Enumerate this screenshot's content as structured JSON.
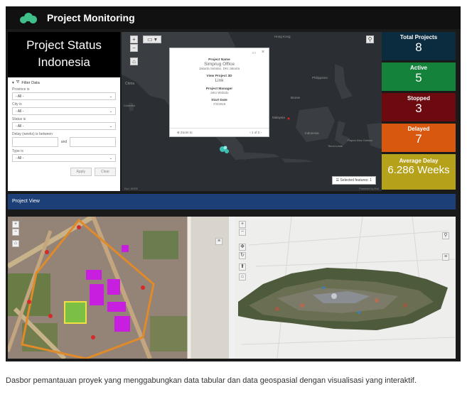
{
  "app": {
    "title": "Project Monitoring"
  },
  "status_panel": {
    "line1": "Project Status",
    "line2": "Indonesia"
  },
  "filter": {
    "heading": "Filter Data",
    "province_label": "Province is",
    "province_value": "- All -",
    "city_label": "City is",
    "city_value": "- All -",
    "status_label": "Status is",
    "status_value": "- All -",
    "delay_label": "Delay (weeks) is between",
    "delay_and": "and",
    "type_label": "Type is",
    "type_value": "- All -",
    "apply_label": "Apply",
    "clear_label": "Clear"
  },
  "map": {
    "popup": {
      "name_key": "Project Name",
      "name_value": "Simprug Office",
      "location": "Jakarta Selatan, DKI Jakarta",
      "view3d_key": "View Project 3D",
      "view3d_link": "Link",
      "manager_key": "Project Manager",
      "manager_value": "Joko Widodo",
      "start_key": "Start Date",
      "start_value": "7/2/2019",
      "zoom_label": "Zoom to",
      "pager": "1 of 2"
    },
    "selected_features": "Selected features: 1",
    "labels": {
      "china": "China",
      "hong_kong": "Hong Kong",
      "philippines": "Philippines",
      "brunei": "Brunei",
      "malaysia": "Malaysia",
      "indonesia": "Indonesia",
      "papua": "Papua New Guinea",
      "timor": "Timor-Leste",
      "colombo": "Colombo"
    },
    "attribution_left": "Esri, HERE",
    "attribution_right": "Powered by Esri"
  },
  "kpis": [
    {
      "label": "Total Projects",
      "value": "8",
      "color": "#0b2b3f"
    },
    {
      "label": "Active",
      "value": "5",
      "color": "#14823a"
    },
    {
      "label": "Stopped",
      "value": "3",
      "color": "#6d0a0f"
    },
    {
      "label": "Delayed",
      "value": "7",
      "color": "#d9580f"
    },
    {
      "label": "Average Delay",
      "value": "6.286 Weeks",
      "color": "#b5a11a"
    }
  ],
  "project_view": {
    "title": "Project View"
  },
  "caption": "Dasbor pemantauan proyek yang menggabungkan data tabular dan data geospasial dengan visualisasi yang interaktif."
}
